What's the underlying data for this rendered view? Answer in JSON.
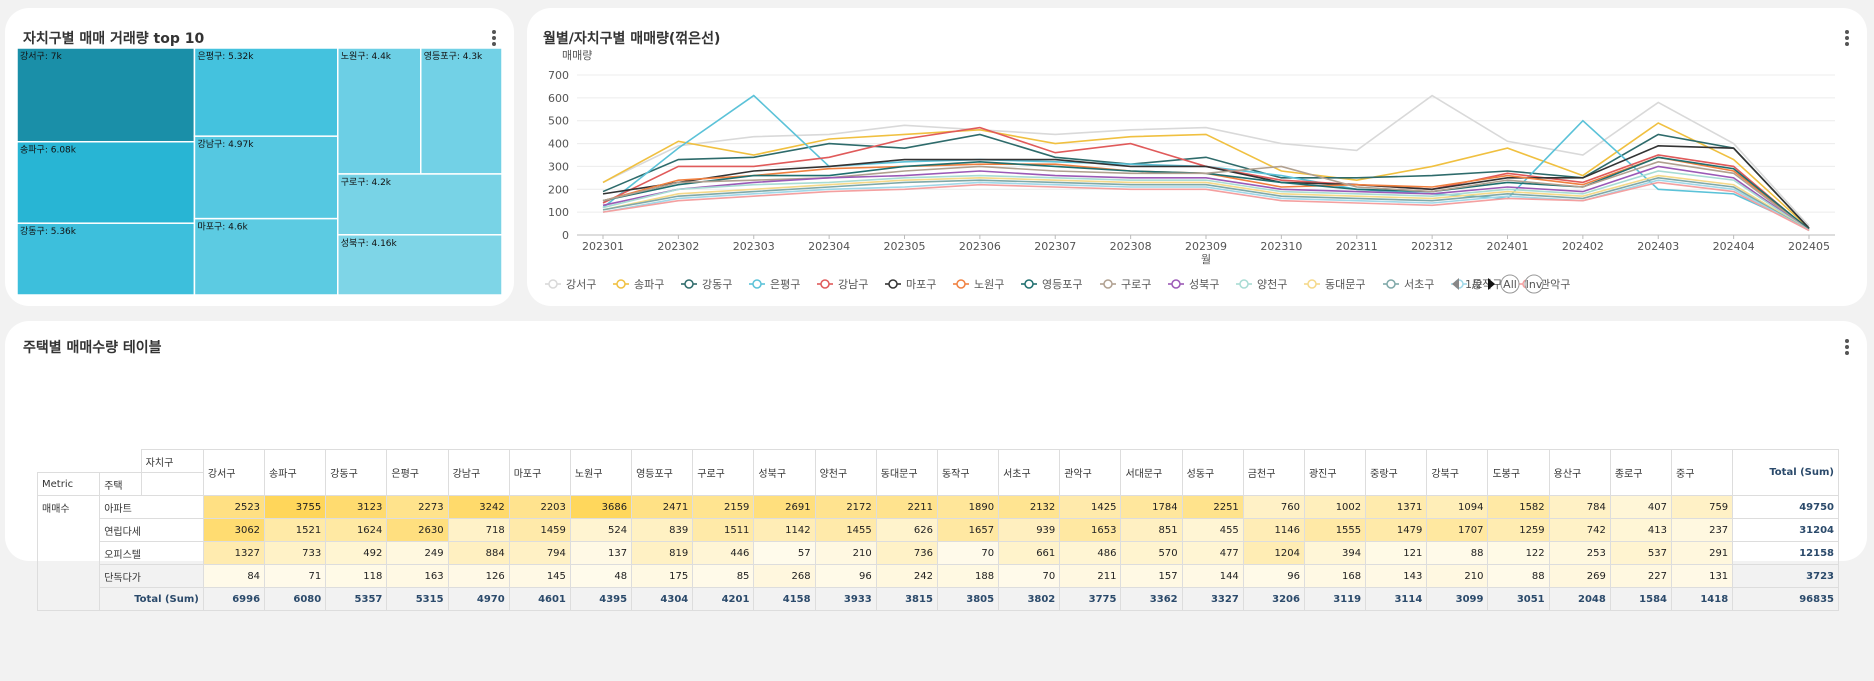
{
  "treemap": {
    "title": "자치구별 매매 거래량 top 10",
    "color": "#2fb6d6",
    "items": [
      {
        "name": "강서구",
        "label": "강서구: 7k",
        "value": 6996,
        "color": "#1a8fa8"
      },
      {
        "name": "송파구",
        "label": "송파구: 6.08k",
        "value": 6080,
        "color": "#28b5d4"
      },
      {
        "name": "강동구",
        "label": "강동구: 5.36k",
        "value": 5357,
        "color": "#3dbfdc"
      },
      {
        "name": "은평구",
        "label": "은평구: 5.32k",
        "value": 5315,
        "color": "#44c2de"
      },
      {
        "name": "강남구",
        "label": "강남구: 4.97k",
        "value": 4970,
        "color": "#55c8e1"
      },
      {
        "name": "마포구",
        "label": "마포구: 4.6k",
        "value": 4601,
        "color": "#5ccbe2"
      },
      {
        "name": "노원구",
        "label": "노원구: 4.4k",
        "value": 4395,
        "color": "#6ccfe5"
      },
      {
        "name": "영등포구",
        "label": "영등포구: 4.3k",
        "value": 4304,
        "color": "#72d1e6"
      },
      {
        "name": "구로구",
        "label": "구로구: 4.2k",
        "value": 4201,
        "color": "#78d3e6"
      },
      {
        "name": "성북구",
        "label": "성북구: 4.16k",
        "value": 4158,
        "color": "#7ed5e7"
      }
    ]
  },
  "linechart": {
    "title": "월별/자치구별 매매량(꺾은선)",
    "ylabel": "매매량",
    "xlabel": "월",
    "pager": "1/2",
    "all_label": "All",
    "inv_label": "Inv",
    "chart_data": {
      "type": "line",
      "x": [
        "202301",
        "202302",
        "202303",
        "202304",
        "202305",
        "202306",
        "202307",
        "202308",
        "202309",
        "202310",
        "202311",
        "202312",
        "202401",
        "202402",
        "202403",
        "202404",
        "202405"
      ],
      "ylim": [
        0,
        700
      ],
      "yticks": [
        0,
        100,
        200,
        300,
        400,
        500,
        600,
        700
      ],
      "grid": true,
      "legend_position": "bottom",
      "series": [
        {
          "name": "강서구",
          "color": "#d9d9d9",
          "values": [
            230,
            390,
            430,
            440,
            480,
            460,
            440,
            460,
            470,
            400,
            370,
            610,
            410,
            350,
            580,
            400,
            40
          ]
        },
        {
          "name": "송파구",
          "color": "#f0c040",
          "values": [
            230,
            410,
            350,
            420,
            440,
            460,
            400,
            430,
            440,
            280,
            240,
            300,
            380,
            260,
            490,
            330,
            30
          ]
        },
        {
          "name": "강동구",
          "color": "#2e6b6b",
          "values": [
            190,
            330,
            340,
            400,
            380,
            440,
            340,
            310,
            340,
            250,
            250,
            260,
            280,
            250,
            440,
            380,
            30
          ]
        },
        {
          "name": "은평구",
          "color": "#5bc2d8",
          "values": [
            120,
            380,
            610,
            300,
            320,
            330,
            320,
            310,
            300,
            260,
            200,
            180,
            160,
            500,
            200,
            180,
            30
          ]
        },
        {
          "name": "강남구",
          "color": "#e05a5a",
          "values": [
            140,
            300,
            300,
            340,
            420,
            470,
            360,
            400,
            300,
            240,
            220,
            200,
            270,
            230,
            350,
            300,
            20
          ]
        },
        {
          "name": "마포구",
          "color": "#333333",
          "values": [
            180,
            230,
            280,
            300,
            330,
            330,
            330,
            300,
            300,
            230,
            220,
            200,
            250,
            250,
            390,
            380,
            30
          ]
        },
        {
          "name": "노원구",
          "color": "#f08040",
          "values": [
            150,
            240,
            260,
            290,
            300,
            310,
            310,
            280,
            270,
            210,
            220,
            210,
            260,
            220,
            340,
            280,
            25
          ]
        },
        {
          "name": "영등포구",
          "color": "#1f6f6f",
          "values": [
            150,
            220,
            260,
            260,
            300,
            320,
            300,
            280,
            270,
            230,
            200,
            190,
            230,
            210,
            340,
            290,
            25
          ]
        },
        {
          "name": "구로구",
          "color": "#b0a090",
          "values": [
            150,
            230,
            240,
            250,
            280,
            300,
            280,
            270,
            270,
            300,
            210,
            190,
            240,
            210,
            320,
            270,
            20
          ]
        },
        {
          "name": "성북구",
          "color": "#9b59b6",
          "values": [
            130,
            200,
            230,
            250,
            260,
            280,
            260,
            250,
            250,
            200,
            190,
            180,
            210,
            190,
            300,
            250,
            20
          ]
        },
        {
          "name": "양천구",
          "color": "#a8dcd4",
          "values": [
            120,
            200,
            220,
            230,
            250,
            260,
            250,
            240,
            240,
            190,
            180,
            170,
            200,
            180,
            280,
            240,
            20
          ]
        },
        {
          "name": "동대문구",
          "color": "#f5d98a",
          "values": [
            110,
            180,
            200,
            220,
            240,
            250,
            240,
            230,
            230,
            180,
            170,
            160,
            190,
            170,
            260,
            220,
            20
          ]
        },
        {
          "name": "서초구",
          "color": "#7fa8a8",
          "values": [
            110,
            170,
            190,
            210,
            230,
            240,
            230,
            220,
            220,
            170,
            160,
            150,
            180,
            160,
            250,
            210,
            20
          ]
        },
        {
          "name": "동작구",
          "color": "#a0d8e8",
          "values": [
            100,
            160,
            180,
            200,
            210,
            230,
            220,
            210,
            210,
            160,
            150,
            140,
            170,
            150,
            240,
            200,
            20
          ]
        },
        {
          "name": "관악구",
          "color": "#f4a0a0",
          "values": [
            100,
            150,
            170,
            190,
            200,
            220,
            210,
            200,
            200,
            150,
            140,
            130,
            160,
            150,
            230,
            190,
            20
          ]
        }
      ]
    }
  },
  "table": {
    "title": "주택별 매매수량 테이블",
    "col_dim": "자치구",
    "metric_label": "Metric",
    "row_dim": "주택",
    "metric_name": "매매수",
    "total_label": "Total (Sum)",
    "districts": [
      "강서구",
      "송파구",
      "강동구",
      "은평구",
      "강남구",
      "마포구",
      "노원구",
      "영등포구",
      "구로구",
      "성북구",
      "양천구",
      "동대문구",
      "동작구",
      "서초구",
      "관악구",
      "서대문구",
      "성동구",
      "금천구",
      "광진구",
      "중랑구",
      "강북구",
      "도봉구",
      "용산구",
      "종로구",
      "중구"
    ],
    "rows": [
      {
        "type": "아파트",
        "values": [
          2523,
          3755,
          3123,
          2273,
          3242,
          2203,
          3686,
          2471,
          2159,
          2691,
          2172,
          2211,
          1890,
          2132,
          1425,
          1784,
          2251,
          760,
          1002,
          1371,
          1094,
          1582,
          784,
          407,
          759
        ],
        "total": 49750
      },
      {
        "type": "연립다세대",
        "values": [
          3062,
          1521,
          1624,
          2630,
          718,
          1459,
          524,
          839,
          1511,
          1142,
          1455,
          626,
          1657,
          939,
          1653,
          851,
          455,
          1146,
          1555,
          1479,
          1707,
          1259,
          742,
          413,
          237
        ],
        "total": 31204
      },
      {
        "type": "오피스텔",
        "values": [
          1327,
          733,
          492,
          249,
          884,
          794,
          137,
          819,
          446,
          57,
          210,
          736,
          70,
          661,
          486,
          570,
          477,
          1204,
          394,
          121,
          88,
          122,
          253,
          537,
          291
        ],
        "total": 12158
      },
      {
        "type": "단독다가구",
        "values": [
          84,
          71,
          118,
          163,
          126,
          145,
          48,
          175,
          85,
          268,
          96,
          242,
          188,
          70,
          211,
          157,
          144,
          96,
          168,
          143,
          210,
          88,
          269,
          227,
          131
        ],
        "total": 3723
      }
    ],
    "col_totals": [
      6996,
      6080,
      5357,
      5315,
      4970,
      4601,
      4395,
      4304,
      4201,
      4158,
      3933,
      3815,
      3805,
      3802,
      3775,
      3362,
      3327,
      3206,
      3119,
      3114,
      3099,
      3051,
      2048,
      1584,
      1418
    ],
    "grand_total": 96835
  }
}
